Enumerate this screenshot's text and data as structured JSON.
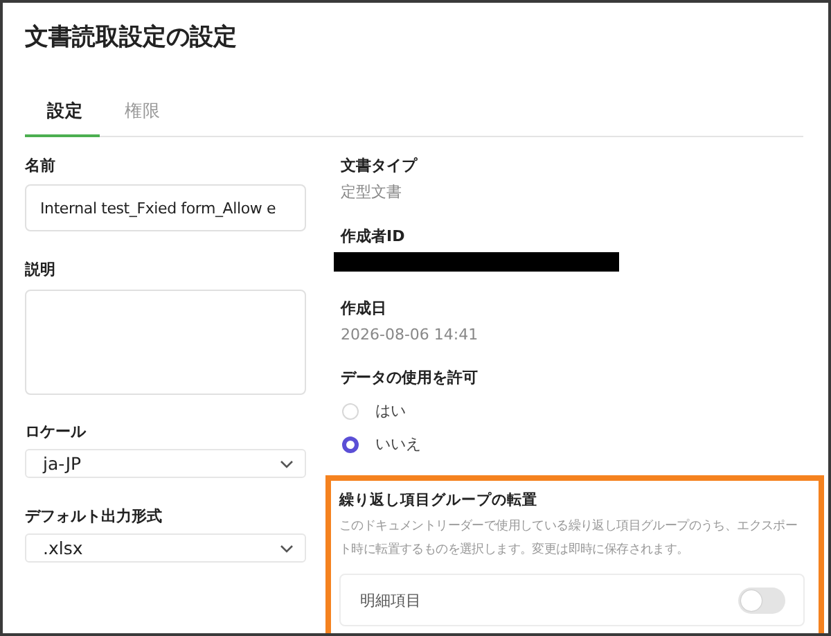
{
  "window": {
    "title": "文書読取設定の設定"
  },
  "tabs": [
    {
      "label": "設定",
      "selected": true
    },
    {
      "label": "権限",
      "selected": false
    }
  ],
  "name": {
    "label": "名前",
    "value": "Internal test_Fxied form_Allow e"
  },
  "description": {
    "label": "説明"
  },
  "locale": {
    "label": "ロケール",
    "value": "ja-JP"
  },
  "output_format": {
    "label": "デフォルト出力形式",
    "value": ".xlsx"
  },
  "document_type": {
    "label": "文書タイプ",
    "value": "定型文書"
  },
  "creator_id": {
    "label": "作成者ID",
    "redacted": true
  },
  "created": {
    "label": "作成日",
    "value": "2026-08-06 14:41"
  },
  "data_usage": {
    "label": "データの使用を許可",
    "options": [
      {
        "label": "はい",
        "selected": false
      },
      {
        "label": "いいえ",
        "selected": true
      }
    ]
  },
  "transpose": {
    "title": "繰り返し項目グループの転置",
    "description": "このドキュメントリーダーで使用している繰り返し項目グループのうち、エクスポート時に転置するものを選択します。変更は即時に保存されます。",
    "highlighted": true,
    "items": [
      {
        "label": "明細項目",
        "on": false
      }
    ]
  }
}
